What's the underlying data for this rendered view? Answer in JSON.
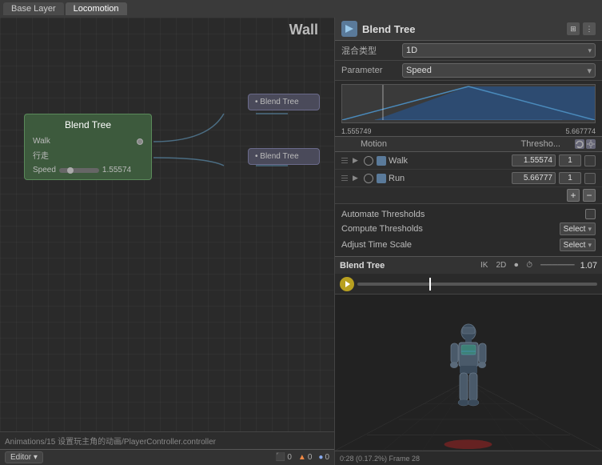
{
  "tabs": {
    "base_layer": "Base Layer",
    "locomotion": "Locomotion"
  },
  "graph": {
    "blend_tree_node": {
      "title": "Blend Tree",
      "walk_label": "Walk",
      "walk_cn": "行走",
      "speed_label": "Speed",
      "speed_value": "1.55574"
    },
    "node_walk": {
      "title": "Blend Tree"
    },
    "node_run": {
      "title": "Blend Tree"
    },
    "wall_label": "Wall",
    "path": "Animations/15 设置玩主角的动画/PlayerController.controller"
  },
  "inspector": {
    "title": "Blend Tree",
    "blend_type_label": "混合类型",
    "blend_type_value": "1D",
    "param_label": "Parameter",
    "param_value": "Speed",
    "range_min": "1.555749",
    "range_max": "5.667774",
    "motion_header": {
      "motion": "Motion",
      "threshold": "Thresho..."
    },
    "motions": [
      {
        "name": "Walk",
        "threshold": "1.55574",
        "extra": "1"
      },
      {
        "name": "Run",
        "threshold": "5.66777",
        "extra": "1"
      }
    ],
    "automate_label": "Automate Thresholds",
    "compute_label": "Compute Thresholds",
    "compute_select": "Select",
    "adjust_label": "Adjust Time Scale",
    "adjust_select": "Select"
  },
  "preview": {
    "title": "Blend Tree",
    "speed": "1.07",
    "time_label": "0:28 (0.17.2%) Frame 28"
  },
  "status": {
    "editor_label": "Editor",
    "errors": "0",
    "warnings": "0",
    "info": "0"
  }
}
